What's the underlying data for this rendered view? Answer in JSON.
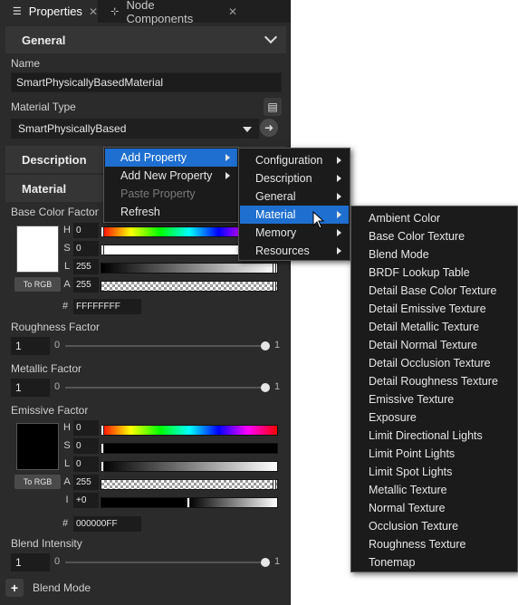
{
  "tabs": {
    "properties": {
      "label": "Properties",
      "icon": "list-icon"
    },
    "node_components": {
      "label": "Node Components",
      "icon": "node-components-icon"
    }
  },
  "general": {
    "section_label": "General",
    "name_label": "Name",
    "name_value": "SmartPhysicallyBasedMaterial",
    "material_type_label": "Material Type",
    "material_type_value": "SmartPhysicallyBased"
  },
  "sections": {
    "description": "Description",
    "material": "Material"
  },
  "base_color": {
    "label": "Base Color Factor",
    "color": "#FFFFFF",
    "H": "0",
    "S": "0",
    "L": "255",
    "A": "255",
    "hex": "FFFFFFFF",
    "to_rgb": "To RGB"
  },
  "roughness": {
    "label": "Roughness Factor",
    "value": "1",
    "min": "0",
    "max": "1",
    "fraction": 1.0
  },
  "metallic": {
    "label": "Metallic Factor",
    "value": "1",
    "min": "0",
    "max": "1",
    "fraction": 1.0
  },
  "emissive": {
    "label": "Emissive Factor",
    "color": "#000000",
    "H": "0",
    "S": "0",
    "L": "0",
    "A": "255",
    "I": "+0",
    "hex": "000000FF",
    "to_rgb": "To RGB"
  },
  "blend_intensity": {
    "label": "Blend Intensity",
    "value": "1",
    "min": "0",
    "max": "1",
    "fraction": 1.0
  },
  "blend_mode": {
    "label": "Blend Mode"
  },
  "context_menu": {
    "items": [
      {
        "label": "Add Property",
        "submenu": true,
        "selected": true
      },
      {
        "label": "Add New Property",
        "submenu": true
      },
      {
        "label": "Paste Property",
        "disabled": true
      },
      {
        "label": "Refresh"
      }
    ]
  },
  "submenu_categories": {
    "items": [
      {
        "label": "Configuration"
      },
      {
        "label": "Description"
      },
      {
        "label": "General"
      },
      {
        "label": "Material",
        "selected": true
      },
      {
        "label": "Memory"
      },
      {
        "label": "Resources"
      }
    ]
  },
  "material_properties": {
    "items": [
      "Ambient Color",
      "Base Color Texture",
      "Blend Mode",
      "BRDF Lookup Table",
      "Detail Base Color Texture",
      "Detail Emissive Texture",
      "Detail Metallic Texture",
      "Detail Normal Texture",
      "Detail Occlusion Texture",
      "Detail Roughness Texture",
      "Emissive Texture",
      "Exposure",
      "Limit Directional Lights",
      "Limit Point Lights",
      "Limit Spot Lights",
      "Metallic Texture",
      "Normal Texture",
      "Occlusion Texture",
      "Roughness Texture",
      "Tonemap"
    ]
  },
  "colors": {
    "accent": "#1E6FD0",
    "panel": "#2B2B2B"
  }
}
